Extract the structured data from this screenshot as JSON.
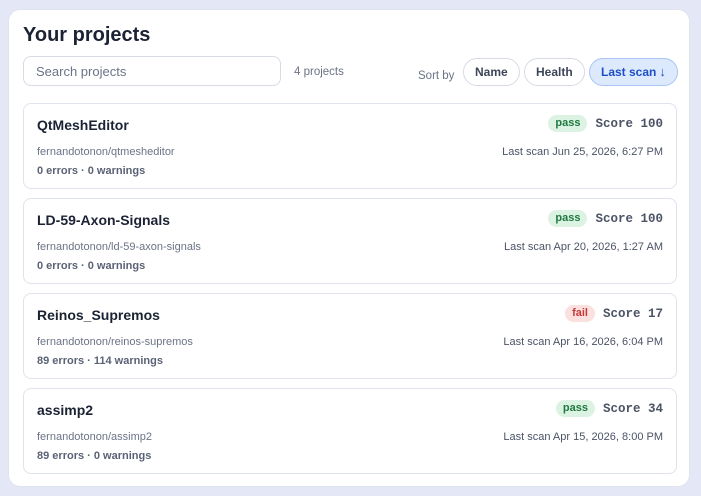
{
  "header": {
    "title": "Your projects"
  },
  "search": {
    "placeholder": "Search projects",
    "value": ""
  },
  "count_label": "4 projects",
  "sort": {
    "label": "Sort by",
    "options": [
      {
        "label": "Name",
        "active": false
      },
      {
        "label": "Health",
        "active": false
      },
      {
        "label": "Last scan",
        "active": true,
        "direction_glyph": "↓"
      }
    ]
  },
  "status_colors": {
    "pass_bg": "#dcf2e3",
    "pass_text": "#1f7a3f",
    "fail_bg": "#fbe0e0",
    "fail_text": "#c53a3a",
    "accent": "#1d4fc4"
  },
  "projects": [
    {
      "name": "QtMeshEditor",
      "status": "pass",
      "score": "Score 100",
      "path": "fernandotonon/qtmesheditor",
      "last_scan": "Last scan Jun 25, 2026, 6:27 PM",
      "issues": "0 errors · 0 warnings"
    },
    {
      "name": "LD-59-Axon-Signals",
      "status": "pass",
      "score": "Score 100",
      "path": "fernandotonon/ld-59-axon-signals",
      "last_scan": "Last scan Apr 20, 2026, 1:27 AM",
      "issues": "0 errors · 0 warnings"
    },
    {
      "name": "Reinos_Supremos",
      "status": "fail",
      "score": "Score 17",
      "path": "fernandotonon/reinos-supremos",
      "last_scan": "Last scan Apr 16, 2026, 6:04 PM",
      "issues": "89 errors · 114 warnings"
    },
    {
      "name": "assimp2",
      "status": "pass",
      "score": "Score 34",
      "path": "fernandotonon/assimp2",
      "last_scan": "Last scan Apr 15, 2026, 8:00 PM",
      "issues": "89 errors · 0 warnings"
    }
  ]
}
